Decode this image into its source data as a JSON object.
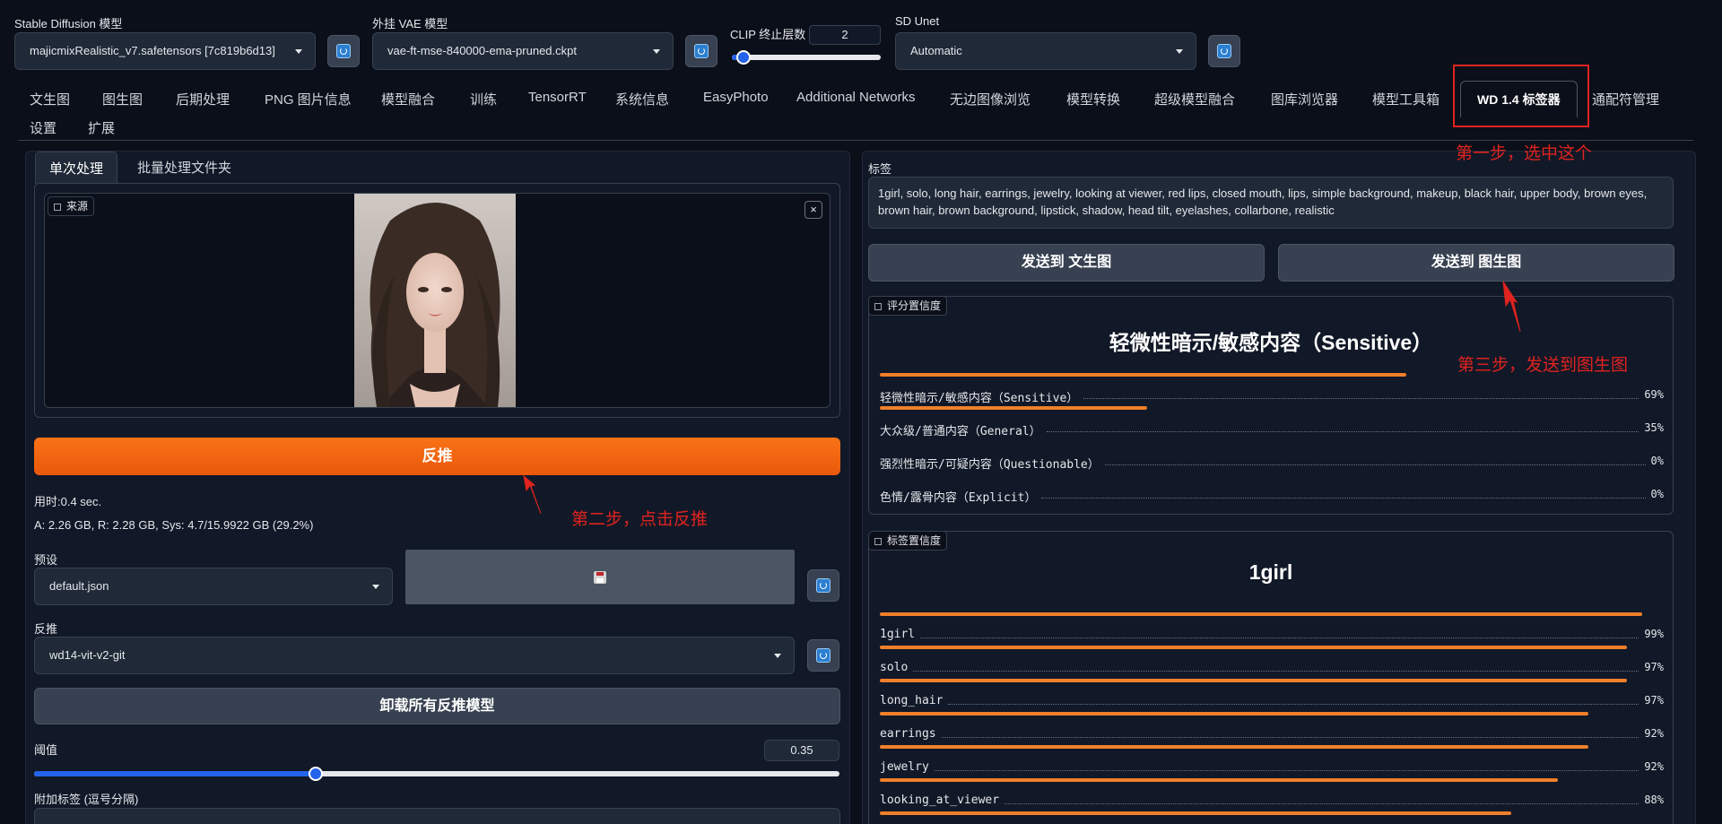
{
  "models": {
    "sd_label": "Stable Diffusion 模型",
    "sd_value": "majicmixRealistic_v7.safetensors [7c819b6d13]",
    "vae_label": "外挂 VAE 模型",
    "vae_value": "vae-ft-mse-840000-ema-pruned.ckpt",
    "clip_label": "CLIP 终止层数",
    "clip_value": "2",
    "clip_fraction": 0.08,
    "unet_label": "SD Unet",
    "unet_value": "Automatic"
  },
  "tabs": [
    "文生图",
    "图生图",
    "后期处理",
    "PNG 图片信息",
    "模型融合",
    "训练",
    "TensorRT",
    "系统信息",
    "EasyPhoto",
    "Additional Networks",
    "无边图像浏览",
    "模型转换",
    "超级模型融合",
    "图库浏览器",
    "模型工具箱",
    "WD 1.4 标签器",
    "通配符管理",
    "设置",
    "扩展"
  ],
  "left": {
    "subtabs": [
      "单次处理",
      "批量处理文件夹"
    ],
    "source_label": "来源",
    "close_glyph": "×",
    "interrogate_label": "反推",
    "time_text": "用时:0.4 sec.",
    "mem_text": "A: 2.26 GB, R: 2.28 GB, Sys: 4.7/15.9922 GB (29.2%)",
    "preset_label": "预设",
    "preset_value": "default.json",
    "interrogator_label": "反推",
    "interrogator_value": "wd14-vit-v2-git",
    "unload_label": "卸载所有反推模型",
    "threshold_label": "阈值",
    "threshold_value": "0.35",
    "threshold_fraction": 0.35,
    "extra_tags_label": "附加标签 (逗号分隔)"
  },
  "right": {
    "tags_label": "标签",
    "tags_text": "1girl, solo, long hair, earrings, jewelry, looking at viewer, red lips, closed mouth, lips, simple background, makeup, black hair, upper body, brown eyes, brown hair, brown background, lipstick, shadow, head tilt, eyelashes, collarbone, realistic",
    "send_txt2img": "发送到 文生图",
    "send_img2img": "发送到 图生图",
    "rating_label": "评分置信度",
    "rating_title": "轻微性暗示/敏感内容（Sensitive）",
    "ratings": [
      {
        "name": "轻微性暗示/敏感内容（Sensitive）",
        "pct": "69%",
        "value": 0.69
      },
      {
        "name": "大众级/普通内容（General）",
        "pct": "35%",
        "value": 0.35
      },
      {
        "name": "强烈性暗示/可疑内容（Questionable）",
        "pct": "0%",
        "value": 0
      },
      {
        "name": "色情/露骨内容（Explicit）",
        "pct": "0%",
        "value": 0
      }
    ],
    "tags_conf_label": "标签置信度",
    "tags_conf_title": "1girl",
    "tag_items": [
      {
        "name": "1girl",
        "pct": "99%",
        "value": 0.99
      },
      {
        "name": "solo",
        "pct": "97%",
        "value": 0.97
      },
      {
        "name": "long_hair",
        "pct": "97%",
        "value": 0.97
      },
      {
        "name": "earrings",
        "pct": "92%",
        "value": 0.92
      },
      {
        "name": "jewelry",
        "pct": "92%",
        "value": 0.92
      },
      {
        "name": "looking_at_viewer",
        "pct": "88%",
        "value": 0.88
      }
    ],
    "next_bar_value": 0.82
  },
  "annotations": {
    "step1": "第一步，选中这个",
    "step2": "第二步，点击反推",
    "step3": "第三步，发送到图生图",
    "color": "#e0231f"
  },
  "colors": {
    "accent": "#f97316",
    "bar": "#f07f2a",
    "slider": "#2563eb",
    "bg": "#0b0f19"
  }
}
